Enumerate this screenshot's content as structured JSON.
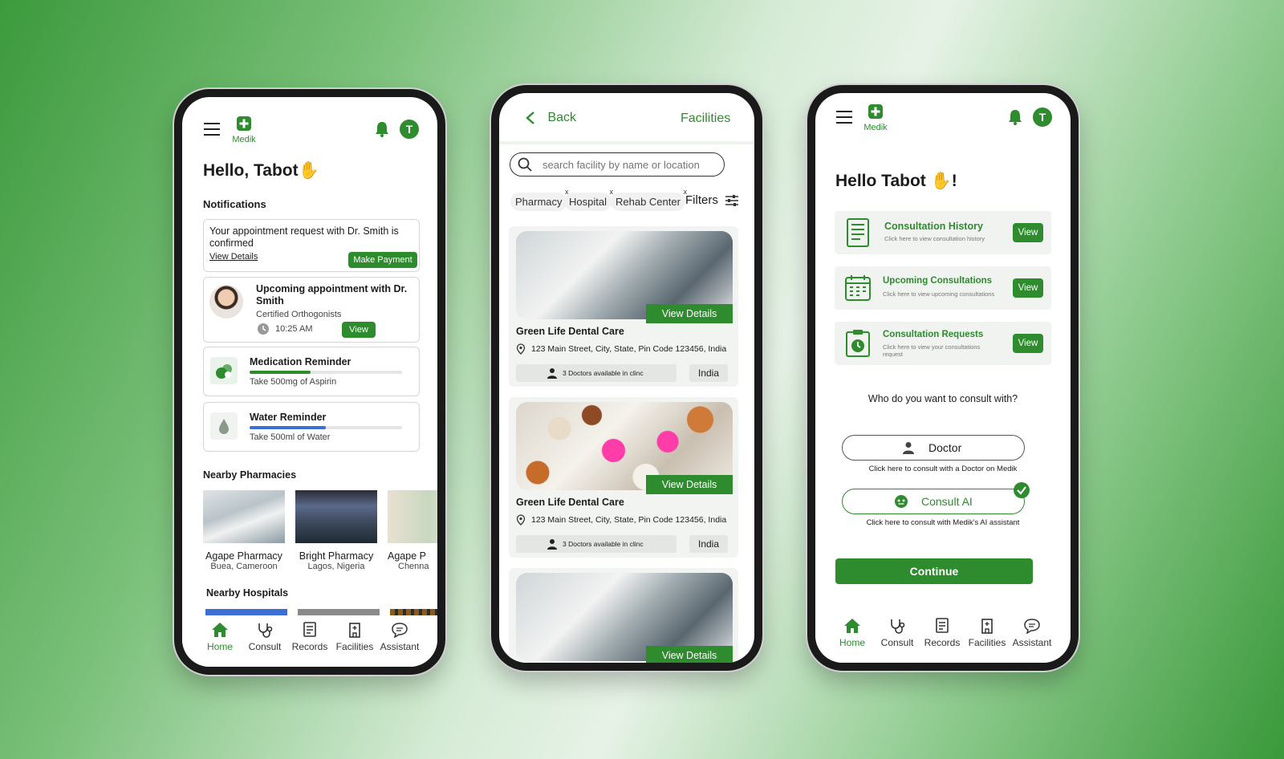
{
  "colors": {
    "accent": "#2e8b2e",
    "water": "#3b6fd6"
  },
  "phone1": {
    "brand": "Medik",
    "avatar_initial": "T",
    "greeting": "Hello, Tabot",
    "notifications_heading": "Notifications",
    "notification": {
      "message": "Your appointment request with Dr. Smith is confirmed",
      "link": "View Details",
      "action": "Make Payment"
    },
    "appointment": {
      "title": "Upcoming appointment with Dr. Smith",
      "subtitle": "Certified Orthogonists",
      "time": "10:25 AM",
      "action": "View"
    },
    "medication": {
      "title": "Medication Reminder",
      "detail": "Take 500mg of Aspirin",
      "progress": 0.4
    },
    "water": {
      "title": "Water Reminder",
      "detail": "Take 500ml of Water",
      "progress": 0.5
    },
    "pharmacies_heading": "Nearby Pharmacies",
    "pharmacies": [
      {
        "name": "Agape Pharmacy",
        "location": "Buea, Cameroon"
      },
      {
        "name": "Bright Pharmacy",
        "location": "Lagos, Nigeria"
      },
      {
        "name": "Agape P",
        "location": "Chenna"
      }
    ],
    "hospitals_heading": "Nearby Hospitals",
    "nav": [
      "Home",
      "Consult",
      "Records",
      "Facilities",
      "Assistant"
    ]
  },
  "phone2": {
    "back": "Back",
    "title": "Facilities",
    "search_placeholder": "search facility by name or location",
    "chips": [
      "Pharmacy",
      "Hospital",
      "Rehab Center"
    ],
    "chip_close": "x",
    "filters": "Filters",
    "facilities": [
      {
        "name": "Green Life Dental Care",
        "address": "123 Main Street, City, State, Pin Code 123456, India",
        "doctors": "3 Doctors available in clinc",
        "country": "India",
        "action": "View Details"
      },
      {
        "name": "Green Life Dental Care",
        "address": "123 Main Street, City, State, Pin Code 123456, India",
        "doctors": "3 Doctors available in clinc",
        "country": "India",
        "action": "View Details"
      },
      {
        "action": "View Details"
      }
    ]
  },
  "phone3": {
    "brand": "Medik",
    "avatar_initial": "T",
    "greeting": "Hello Tabot",
    "greeting_end": "!",
    "items": [
      {
        "title": "Consultation History",
        "subtitle": "Click here to view consultation history",
        "action": "View"
      },
      {
        "title": "Upcoming Consultations",
        "subtitle": "Click here to view upcoming consultations",
        "action": "View"
      },
      {
        "title": "Consultation Requests",
        "subtitle": "Click here to view your consultations request",
        "action": "View"
      }
    ],
    "question": "Who do you want to consult with?",
    "doctor_option": {
      "label": "Doctor",
      "hint": "Click here to consult with a Doctor on Medik"
    },
    "ai_option": {
      "label": "Consult AI",
      "hint": "Click here to consult with Medik's AI assistant"
    },
    "continue": "Continue",
    "nav": [
      "Home",
      "Consult",
      "Records",
      "Facilities",
      "Assistant"
    ]
  }
}
